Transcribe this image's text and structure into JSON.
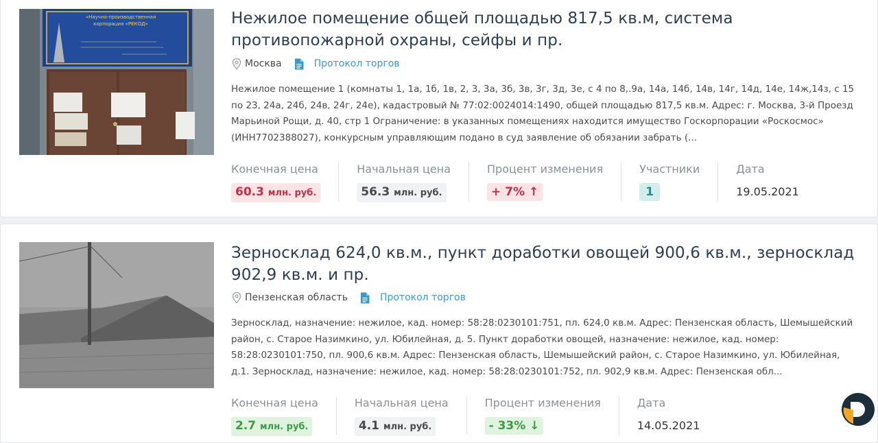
{
  "listings": [
    {
      "title": "Нежилое помещение общей площадью 817,5 кв.м, система противопожарной охраны, сейфы и пр.",
      "location": "Москва",
      "protocol_link": "Протокол торгов",
      "photo_sign_lines": [
        "«Научно-производственная",
        "корпорация «РЕКОД»"
      ],
      "description": "Нежилое помещение 1 (комнаты 1, 1а, 1б, 1в, 2, 3, 3а, 3б, 3в, 3г, 3д, 3е, с 4 по 8,.9а, 14а, 14б, 14в, 14г, 14д, 14е, 14ж,14з, с 15 по 23, 24а, 24б, 24в, 24г, 24е), кадастровый № 77:02:0024014:1490, общей площадью 817,5 кв.м. Адрес: г. Москва, 3-й Проезд Марьиной Рощи, д. 40, стр 1 Ограничение: в указанных помещениях находится имущество Госкорпорации «Роскосмос» (ИНН7702388027), конкурсным управляющим подано в суд заявление об обязании забрать (...",
      "final_price_label": "Конечная цена",
      "final_price_value": "60.3",
      "final_price_unit": "млн. руб.",
      "start_price_label": "Начальная цена",
      "start_price_value": "56.3",
      "start_price_unit": "млн. руб.",
      "change_label": "Процент изменения",
      "change_value": "+ 7%",
      "change_arrow": "↑",
      "participants_label": "Участники",
      "participants_value": "1",
      "date_label": "Дата",
      "date_value": "19.05.2021"
    },
    {
      "title": "Зерносклад 624,0 кв.м., пункт доработки овощей 900,6 кв.м., зерносклад 902,9 кв.м. и пр.",
      "location": "Пензенская область",
      "protocol_link": "Протокол торгов",
      "description": "Зерносклад, назначение: нежилое, кад. номер: 58:28:0230101:751, пл. 624,0 кв.м. Адрес: Пензенская область, Шемышейский район, с. Старое Назимкино, ул. Юбилейная, д. 5. Пункт доработки овощей, назначение: нежилое, кад. номер: 58:28:0230101:750, пл. 900,6 кв.м. Адрес: Пензенская область, Шемышейский район, с. Старое Назимкино, ул. Юбилейная, д.1. Зерносклад, назначение: нежилое, кад. номер: 58:28:0230101:752, пл. 902,9 кв.м. Адрес: Пензенская обл...",
      "final_price_label": "Конечная цена",
      "final_price_value": "2.7",
      "final_price_unit": "млн. руб.",
      "start_price_label": "Начальная цена",
      "start_price_value": "4.1",
      "start_price_unit": "млн. руб.",
      "change_label": "Процент изменения",
      "change_value": "- 33%",
      "change_arrow": "↓",
      "date_label": "Дата",
      "date_value": "14.05.2021"
    }
  ],
  "colors": {
    "title": "#2d3e50",
    "link": "#3c99c8",
    "price_up": "#c2304a",
    "price_down": "#3e9a47",
    "participants": "#2b8b8b",
    "logo_orange": "#f5a623",
    "logo_dark": "#1e2d3a"
  },
  "icons": [
    "location-pin-icon",
    "document-icon",
    "arrow-up-icon",
    "arrow-down-icon",
    "site-logo-icon"
  ]
}
